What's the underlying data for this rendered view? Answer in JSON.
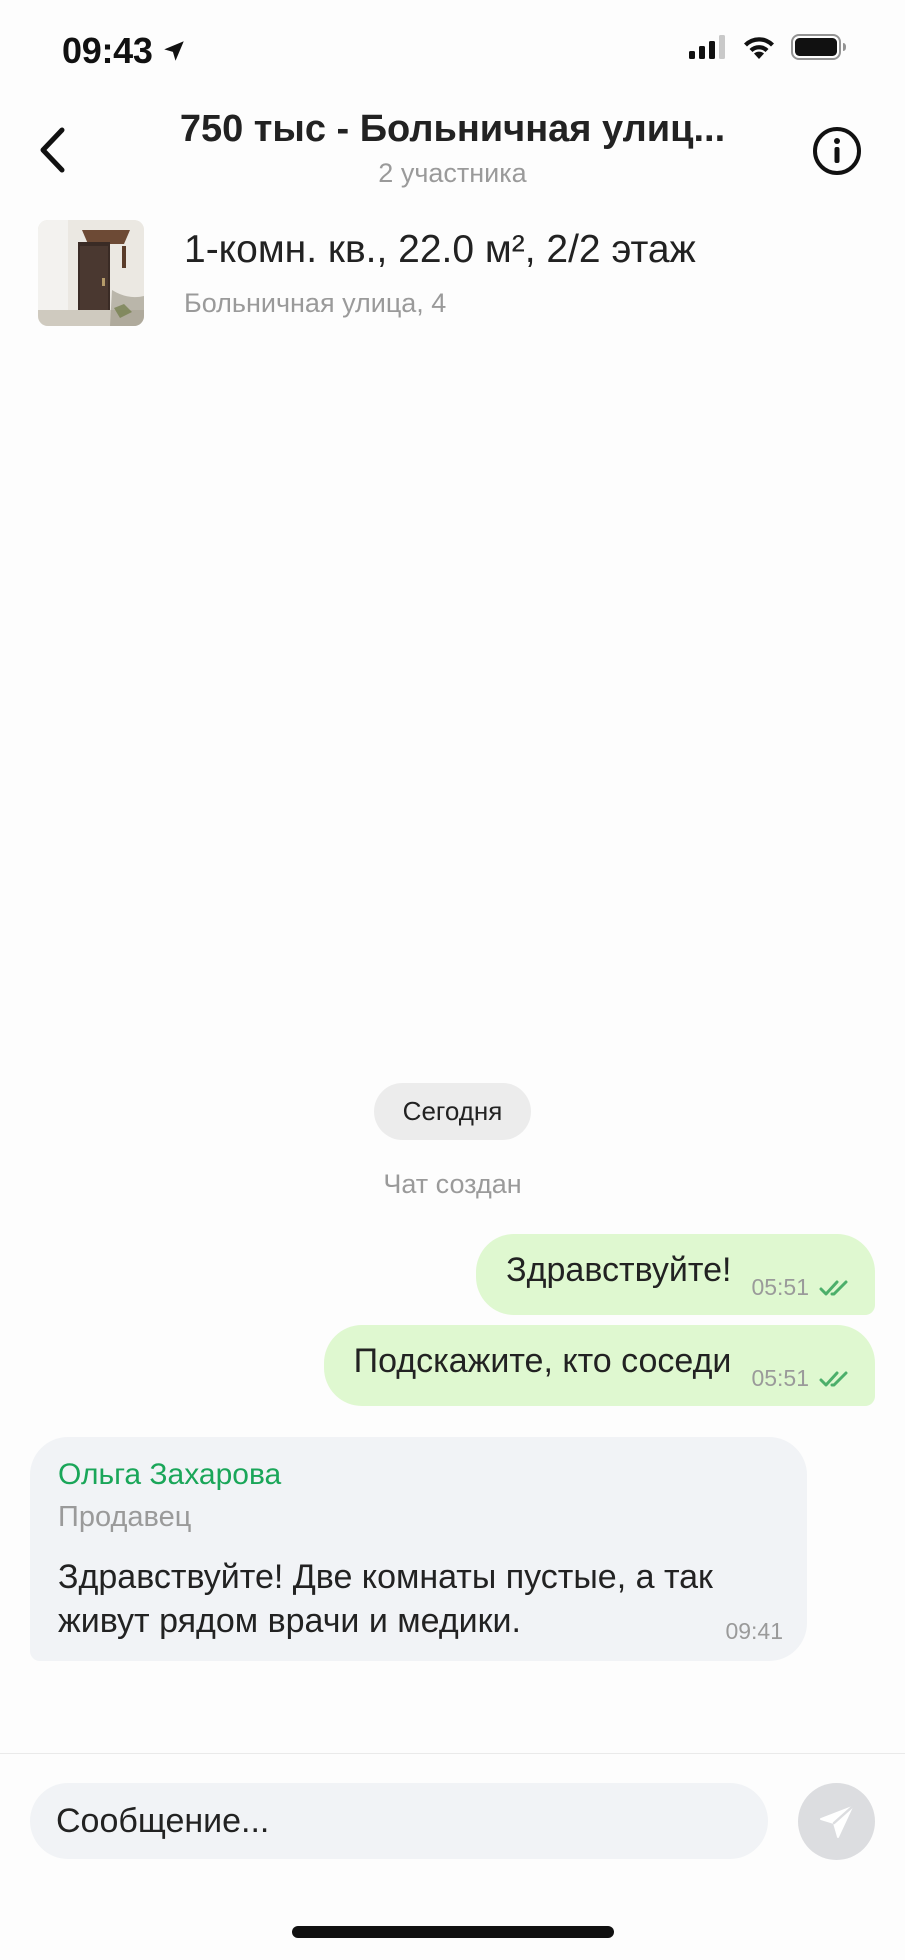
{
  "status_bar": {
    "time": "09:43",
    "icons": [
      "location-arrow-icon",
      "cellular-signal-icon",
      "wifi-icon",
      "battery-icon"
    ]
  },
  "header": {
    "title": "750 тыс - Больничная улиц...",
    "subtitle": "2 участника",
    "back_icon": "chevron-left-icon",
    "info_icon": "info-icon"
  },
  "listing": {
    "title": "1-комн. кв., 22.0 м², 2/2 этаж",
    "address": "Больничная улица, 4"
  },
  "chat": {
    "date_label": "Сегодня",
    "system_note": "Чат создан",
    "outgoing": [
      {
        "text": "Здравствуйте!",
        "time": "05:51",
        "status": "read"
      },
      {
        "text": "Подскажите, кто соседи",
        "time": "05:51",
        "status": "read"
      }
    ],
    "incoming": {
      "sender": "Ольга Захарова",
      "role": "Продавец",
      "text": "Здравствуйте! Две комнаты пустые, а так живут рядом врачи и медики.",
      "time": "09:41"
    }
  },
  "composer": {
    "placeholder": "Сообщение...",
    "send_icon": "send-icon"
  },
  "colors": {
    "outgoing_bubble": "#dff8d0",
    "incoming_bubble": "#f1f3f6",
    "sender_name": "#1aa659",
    "read_checks": "#4caf6a",
    "muted_text": "#9a9a9a"
  }
}
